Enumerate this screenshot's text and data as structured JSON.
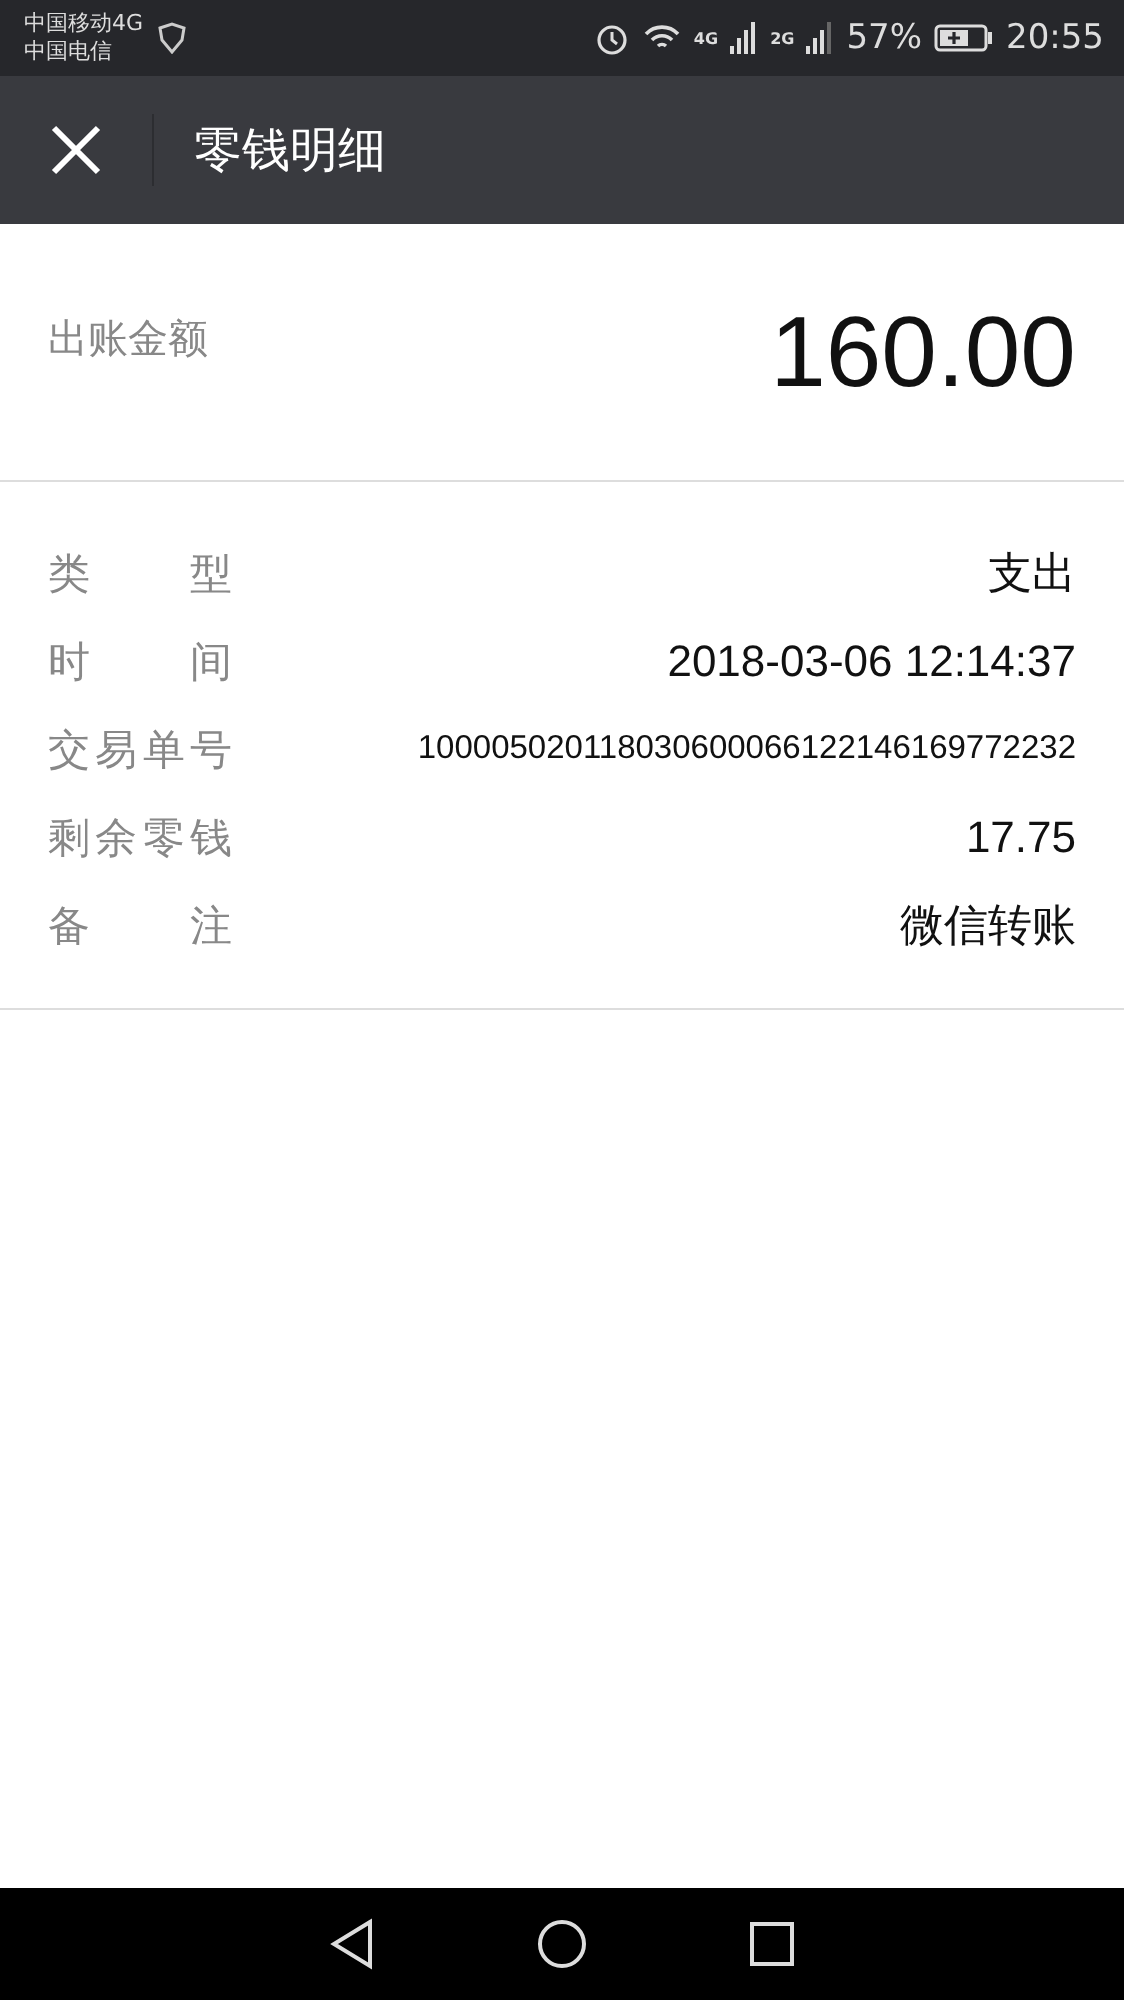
{
  "status_bar": {
    "carriers": [
      "中国移动4G",
      "中国电信"
    ],
    "battery_percent": "57%",
    "time": "20:55",
    "network_1": "4G",
    "network_2": "2G"
  },
  "header": {
    "title": "零钱明细"
  },
  "amount": {
    "label": "出账金额",
    "value": "160.00"
  },
  "details": [
    {
      "label": "类 型",
      "value": "支出"
    },
    {
      "label": "时 间",
      "value": "2018-03-06 12:14:37"
    },
    {
      "label": "交易单号",
      "value": "100005020118030600066122146169772232",
      "kind": "small"
    },
    {
      "label": "剩余零钱",
      "value": "17.75"
    },
    {
      "label": "备 注",
      "value": "微信转账"
    }
  ]
}
